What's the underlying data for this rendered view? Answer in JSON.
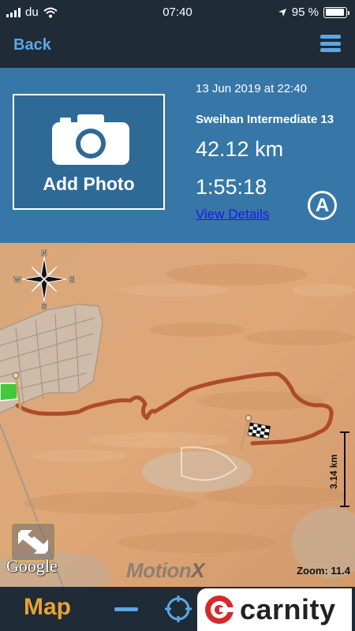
{
  "status_bar": {
    "carrier": "du",
    "time": "07:40",
    "battery": "95 %",
    "battery_level": 0.95,
    "icons": [
      "signal-icon",
      "wifi-icon",
      "location-arrow-icon",
      "battery-icon"
    ]
  },
  "nav": {
    "back_label": "Back",
    "menu_icon": "hamburger-menu-icon"
  },
  "trip": {
    "add_photo_label": "Add Photo",
    "date": "13 Jun 2019 at 22:40",
    "name": "Sweihan Intermediate 13",
    "distance": "42.12 km",
    "duration": "1:55:18",
    "details_link": "View Details",
    "badge": "A"
  },
  "map": {
    "compass": {
      "n": "N",
      "s": "S",
      "e": "E",
      "w": "W"
    },
    "scale": "3.14 km",
    "google": "Google",
    "brand_motion": "Motion",
    "brand_x": "X",
    "zoom": "Zoom: 11.4",
    "route_color": "#a8421f"
  },
  "toolbar": {
    "map_label": "Map",
    "carnity": "carnity"
  },
  "colors": {
    "bar_bg": "#1f2b36",
    "panel_bg": "#3677a8",
    "accent_blue": "#5ba7e4",
    "accent_orange": "#e8a233",
    "carnity_red": "#d42a2a"
  }
}
